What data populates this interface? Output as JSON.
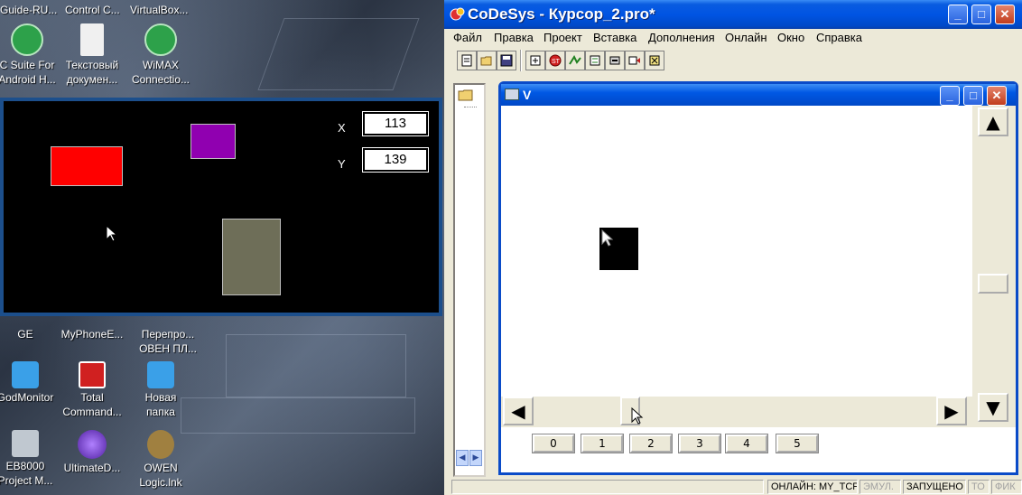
{
  "desktop": {
    "top_labels": [
      "Guide-RU...",
      "Control C...",
      "VirtualBox..."
    ],
    "icons": [
      {
        "label1": "C Suite For",
        "label2": "Android H...",
        "icon": "android-suite-icon",
        "color": "#2da14a"
      },
      {
        "label1": "Текстовый",
        "label2": "докумен...",
        "icon": "text-document-icon",
        "color": "#e8e8e8"
      },
      {
        "label1": "WiMAX",
        "label2": "Connectio...",
        "icon": "wimax-icon",
        "color": "#2da14a"
      },
      {
        "label1": "GE",
        "label2": "",
        "icon": "ge-icon",
        "color": "#5a6a80"
      },
      {
        "label1": "MyPhoneE...",
        "label2": "",
        "icon": "myphone-icon",
        "color": "#5a6a80"
      },
      {
        "label1": "Перепро...",
        "label2": "ОВЕН ПЛ...",
        "icon": "owen-programmer-icon",
        "color": "#5a6a80"
      },
      {
        "label1": "GodMonitor",
        "label2": "",
        "icon": "godmonitor-icon",
        "color": "#3aa0e8"
      },
      {
        "label1": "Total",
        "label2": "Command...",
        "icon": "total-commander-icon",
        "color": "#d02020"
      },
      {
        "label1": "Новая",
        "label2": "папка",
        "icon": "new-folder-icon",
        "color": "#3aa0e8"
      },
      {
        "label1": "EB8000",
        "label2": "Project M...",
        "icon": "eb8000-icon",
        "color": "#c0c8d0"
      },
      {
        "label1": "UltimateD...",
        "label2": "",
        "icon": "ultimatedefrag-icon",
        "color": "#7040c0"
      },
      {
        "label1": "OWEN",
        "label2": "Logic.lnk",
        "icon": "owen-logic-icon",
        "color": "#a08040"
      }
    ]
  },
  "visu": {
    "x_label": "X",
    "y_label": "Y",
    "x_value": "113",
    "y_value": "139",
    "colors": {
      "red": "#ff0000",
      "purple": "#9000b0",
      "olive": "#6e6e58"
    }
  },
  "app": {
    "title": "CoDeSys - Курсор_2.pro*",
    "menu": [
      "Файл",
      "Правка",
      "Проект",
      "Вставка",
      "Дополнения",
      "Онлайн",
      "Окно",
      "Справка"
    ],
    "toolbar_icons": [
      "new-file-icon",
      "open-folder-icon",
      "save-icon",
      "build-icon",
      "stop-icon",
      "login-icon",
      "logout-icon",
      "run-icon",
      "step-icon",
      "breakpoint-icon"
    ],
    "child_window": {
      "title": "V",
      "buttons": [
        "0",
        "1",
        "2",
        "3",
        "4",
        "5"
      ]
    },
    "status": {
      "online": "ОНЛАЙН: MY_TCP",
      "emul": "ЭМУЛ.",
      "running": "ЗАПУЩЕНО",
      "to": "ТО",
      "fik": "ФИК"
    }
  }
}
